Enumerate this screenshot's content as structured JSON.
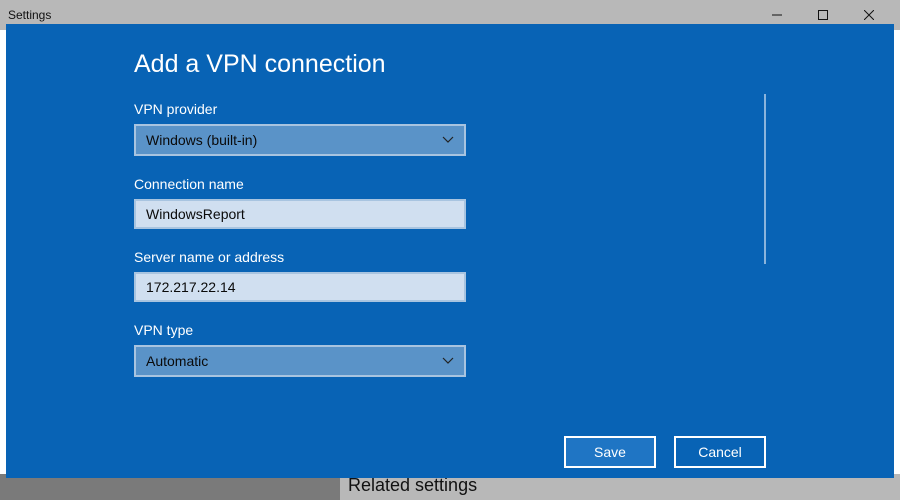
{
  "window": {
    "title": "Settings"
  },
  "background": {
    "related_heading": "Related settings"
  },
  "dialog": {
    "title": "Add a VPN connection",
    "fields": {
      "vpn_provider": {
        "label": "VPN provider",
        "value": "Windows (built-in)"
      },
      "connection_name": {
        "label": "Connection name",
        "value": "WindowsReport"
      },
      "server": {
        "label": "Server name or address",
        "value": "172.217.22.14"
      },
      "vpn_type": {
        "label": "VPN type",
        "value": "Automatic"
      }
    },
    "buttons": {
      "save": "Save",
      "cancel": "Cancel"
    }
  }
}
